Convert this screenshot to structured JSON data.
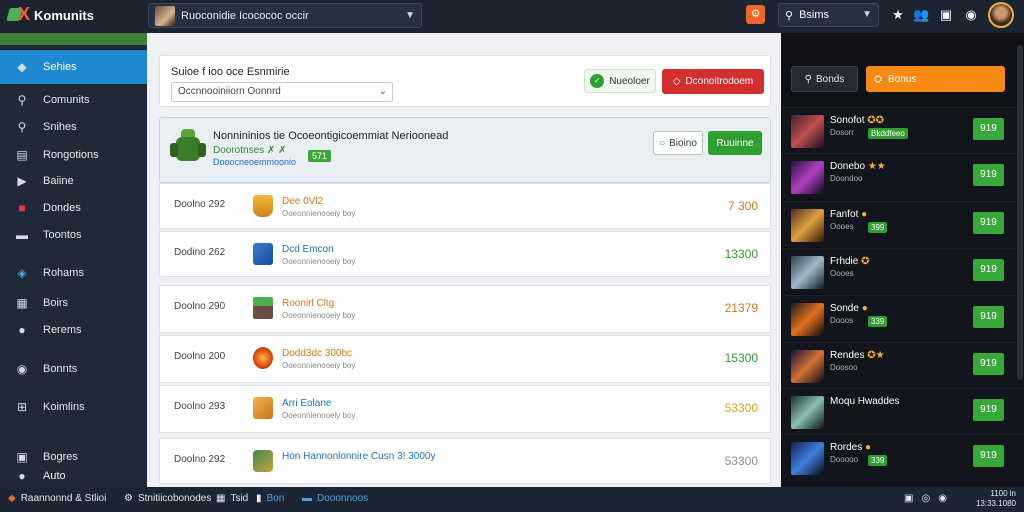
{
  "topbar": {
    "logo_text": "Komunits",
    "app_select": "Ruoconidie Icocococ occir",
    "user_select": "Bsims"
  },
  "sidebar": {
    "items": [
      {
        "label": "Sehies",
        "icon": "layers-icon"
      },
      {
        "label": "Comunits",
        "icon": "search-icon"
      },
      {
        "label": "Snihes",
        "icon": "search-icon"
      },
      {
        "label": "Rongotions",
        "icon": "list-icon"
      },
      {
        "label": "Baiine",
        "icon": "play-icon"
      },
      {
        "label": "Dondes",
        "icon": "flag-icon"
      },
      {
        "label": "Toontos",
        "icon": "square-icon"
      },
      {
        "label": "Rohams",
        "icon": "cube-icon"
      },
      {
        "label": "Boirs",
        "icon": "grid-icon"
      },
      {
        "label": "Rerems",
        "icon": "apple-icon"
      },
      {
        "label": "Bonnts",
        "icon": "circle-icon"
      },
      {
        "label": "Koimlins",
        "icon": "windows-icon"
      },
      {
        "label": "Bogres",
        "icon": "store-icon"
      },
      {
        "label": "Auto",
        "icon": "user-icon"
      }
    ]
  },
  "filter": {
    "title": "Suioe f ioo oce Esnmirie",
    "input_value": "Occnnooiniiorn Oonnrd",
    "btn_green": "Nueoloer",
    "btn_red": "Dconoitrodoem"
  },
  "featured": {
    "title": "Nonnininios tie Ocoeontigicoemmiat Nerioonead",
    "sub": "Doorotnses ✗ ✗",
    "link": "Dooocneoemmoonio",
    "badge": "571",
    "btn_outline": "Bioino",
    "btn_solid": "Ruuinne"
  },
  "rows": [
    {
      "name": "Doolno 292",
      "title": "Dee 0Vl2",
      "sub": "Ooeonnienooeiy boy",
      "value": "7 300",
      "title_color": "#d8751c",
      "value_color": "#d8751c",
      "icon": "trophy-icon"
    },
    {
      "name": "Dodino 262",
      "title": "Dcd Emcon",
      "sub": "Ooeonnienooeiy boy",
      "value": "13300",
      "title_color": "#1f6fc1",
      "value_color": "#2e9e2e",
      "icon": "cube-icon"
    },
    {
      "name": "Doolno 290",
      "title": "Roonirl Cltg",
      "sub": "Ooeonnienooeiy boy",
      "value": "21379",
      "title_color": "#d8751c",
      "value_color": "#d8751c",
      "icon": "block-icon"
    },
    {
      "name": "Doolno 200",
      "title": "Dodd3dc 300bc",
      "sub": "Ooeonnienooeiy boy",
      "value": "15300",
      "title_color": "#d8751c",
      "value_color": "#2e9e2e",
      "icon": "orb-icon"
    },
    {
      "name": "Doolno 293",
      "title": "Arri Eolane",
      "sub": "Ooeonnienooeiy boy",
      "value": "53300",
      "title_color": "#1f6fc1",
      "value_color": "#d8a21c",
      "icon": "box-icon"
    },
    {
      "name": "Doolno 292",
      "title": "Hon Hannonlonnire Cusn 3! 3000y",
      "sub": "",
      "value": "53300",
      "title_color": "#1f6fc1",
      "value_color": "#8a8f96",
      "icon": "creature-icon"
    }
  ],
  "right_panel": {
    "btn_dark": "Bonds",
    "btn_orange": "Bonus",
    "items": [
      {
        "name": "Sonofot",
        "badges": "✪✪",
        "sub": "Dosorr",
        "tag": "Bkddfeeo",
        "score": "919"
      },
      {
        "name": "Donebo",
        "badges": "★★",
        "sub": "Doondoo",
        "tag": "",
        "score": "919"
      },
      {
        "name": "Fanfot",
        "badges": "●",
        "sub": "Oooes",
        "tag": "399",
        "score": "919"
      },
      {
        "name": "Frhdie",
        "badges": "✪",
        "sub": "Oooes",
        "tag": "",
        "score": "919"
      },
      {
        "name": "Sonde",
        "badges": "●",
        "sub": "Dooos",
        "tag": "339",
        "score": "919"
      },
      {
        "name": "Rendes",
        "badges": "✪★",
        "sub": "Doosoo",
        "tag": "",
        "score": "919"
      },
      {
        "name": "Moqu Hwaddes",
        "badges": "",
        "sub": "",
        "tag": "",
        "score": "919"
      },
      {
        "name": "Rordes",
        "badges": "●",
        "sub": "Dooooo",
        "tag": "339",
        "score": "919"
      }
    ]
  },
  "statusbar": {
    "app": "Raannonnd & Stlioi",
    "item2": "Stnitiicobonodes",
    "item3": "Tsid",
    "item4": "Bon",
    "item5": "Dooonnoos",
    "time": "1100 ln",
    "date": "13:33.1080"
  }
}
